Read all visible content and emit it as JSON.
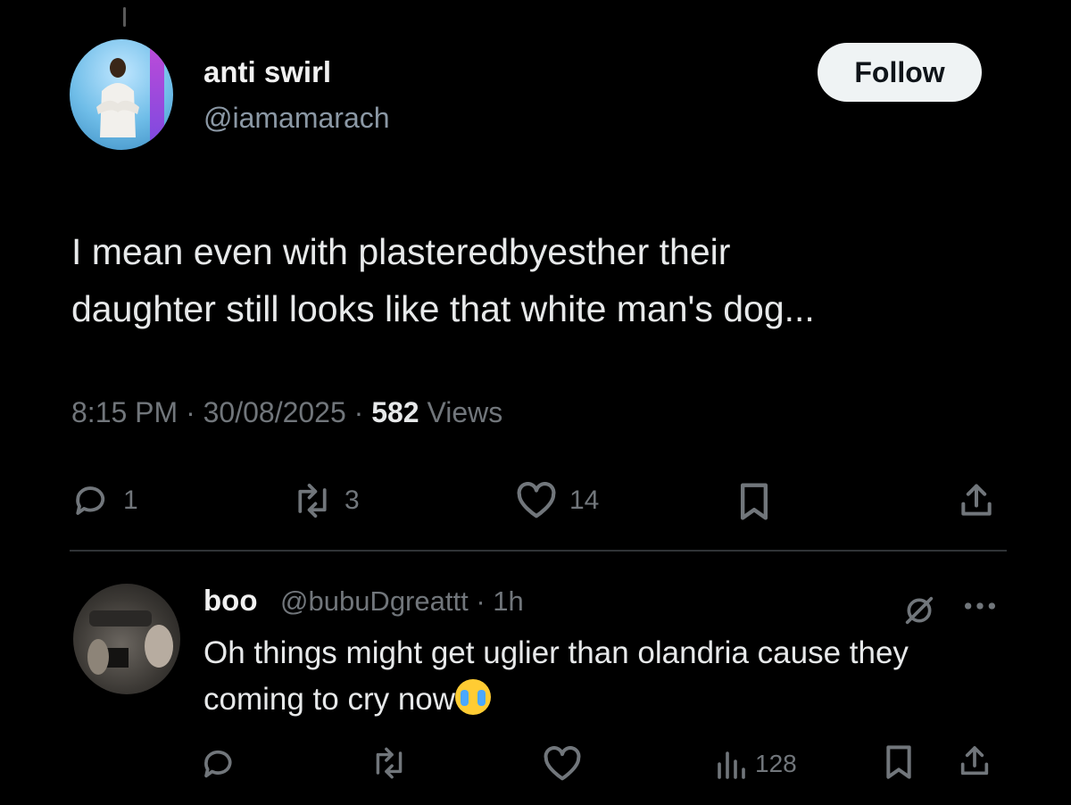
{
  "tweet": {
    "author_name": "anti swirl",
    "author_handle": "@iamamarach",
    "follow_label": "Follow",
    "text": "I mean even with plasteredbyesther their\ndaughter still looks like that white man's dog...",
    "time": "8:15 PM",
    "date": "30/08/2025",
    "sep": "·",
    "views_count": "582",
    "views_label": "Views",
    "replies": "1",
    "reposts": "3",
    "likes": "14"
  },
  "reply": {
    "author_name": "boo",
    "author_handle": "@bubuDgreattt · 1h",
    "text": "Oh things might get uglier than olandria cause they coming to cry now",
    "emoji": "loudly-crying-face-emoji",
    "views": "128"
  },
  "icons": {
    "reply": "speech-bubble-icon",
    "repost": "repost-arrows-icon",
    "like": "heart-icon",
    "bookmark": "bookmark-icon",
    "share": "share-icon",
    "views": "bar-chart-icon",
    "grok": "grok-icon",
    "more": "more-dots-icon"
  },
  "colors": {
    "background": "#000000",
    "text": "#e7e9ea",
    "secondary": "#71767b",
    "follow_button_bg": "#eff3f4"
  }
}
